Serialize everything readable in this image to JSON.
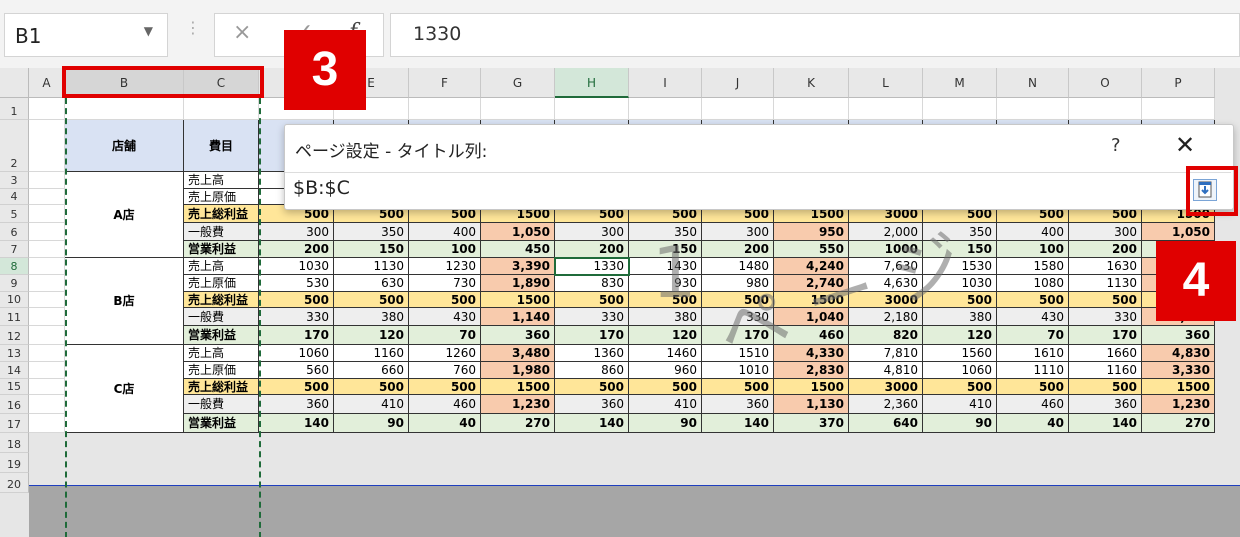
{
  "formula_bar": {
    "name_box": "B1",
    "cancel_icon": "×",
    "enter_icon": "✓",
    "fx_icon": "f",
    "formula_value": "1330"
  },
  "columns": [
    "A",
    "B",
    "C",
    "D",
    "E",
    "F",
    "G",
    "H",
    "I",
    "J",
    "K",
    "L",
    "M",
    "N",
    "O",
    "P"
  ],
  "rows": [
    "1",
    "2",
    "3",
    "4",
    "5",
    "6",
    "7",
    "8",
    "9",
    "10",
    "11",
    "12",
    "13",
    "14",
    "15",
    "16",
    "17",
    "18",
    "19",
    "20"
  ],
  "table": {
    "header": {
      "store": "店舗",
      "item": "費目"
    },
    "stores": [
      "A店",
      "B店",
      "C店"
    ],
    "line_items": [
      "売上高",
      "売上原価",
      "売上総利益",
      "一般費",
      "営業利益"
    ],
    "data": [
      [
        "",
        "",
        "",
        "",
        "",
        "",
        "",
        "",
        "",
        "",
        "",
        "",
        ""
      ],
      [
        "",
        "",
        "",
        "",
        "",
        "",
        "",
        "",
        "",
        "",
        "",
        "",
        ""
      ],
      [
        "500",
        "500",
        "500",
        "1500",
        "500",
        "500",
        "500",
        "1500",
        "3000",
        "500",
        "500",
        "500",
        "1500"
      ],
      [
        "300",
        "350",
        "400",
        "1,050",
        "300",
        "350",
        "300",
        "950",
        "2,000",
        "350",
        "400",
        "300",
        "1,050"
      ],
      [
        "200",
        "150",
        "100",
        "450",
        "200",
        "150",
        "200",
        "550",
        "1000",
        "150",
        "100",
        "200",
        "450"
      ],
      [
        "1030",
        "1130",
        "1230",
        "3,390",
        "1330",
        "1430",
        "1480",
        "4,240",
        "7,630",
        "1530",
        "1580",
        "1630",
        "4,740"
      ],
      [
        "530",
        "630",
        "730",
        "1,890",
        "830",
        "930",
        "980",
        "2,740",
        "4,630",
        "1030",
        "1080",
        "1130",
        "3,240"
      ],
      [
        "500",
        "500",
        "500",
        "1500",
        "500",
        "500",
        "500",
        "1500",
        "3000",
        "500",
        "500",
        "500",
        "1500"
      ],
      [
        "330",
        "380",
        "430",
        "1,140",
        "330",
        "380",
        "330",
        "1,040",
        "2,180",
        "380",
        "430",
        "330",
        "1,140"
      ],
      [
        "170",
        "120",
        "70",
        "360",
        "170",
        "120",
        "170",
        "460",
        "820",
        "120",
        "70",
        "170",
        "360"
      ],
      [
        "1060",
        "1160",
        "1260",
        "3,480",
        "1360",
        "1460",
        "1510",
        "4,330",
        "7,810",
        "1560",
        "1610",
        "1660",
        "4,830"
      ],
      [
        "560",
        "660",
        "760",
        "1,980",
        "860",
        "960",
        "1010",
        "2,830",
        "4,810",
        "1060",
        "1110",
        "1160",
        "3,330"
      ],
      [
        "500",
        "500",
        "500",
        "1500",
        "500",
        "500",
        "500",
        "1500",
        "3000",
        "500",
        "500",
        "500",
        "1500"
      ],
      [
        "360",
        "410",
        "460",
        "1,230",
        "360",
        "410",
        "360",
        "1,130",
        "2,360",
        "410",
        "460",
        "360",
        "1,230"
      ],
      [
        "140",
        "90",
        "40",
        "270",
        "140",
        "90",
        "140",
        "370",
        "640",
        "90",
        "40",
        "140",
        "270"
      ]
    ]
  },
  "dialog": {
    "title": "ページ設定 - タイトル列:",
    "help": "?",
    "close": "✕",
    "value": "$B:$C"
  },
  "watermark": {
    "page_num": "1",
    "page_label": "ページ"
  },
  "annotations": {
    "step3": "3",
    "step4": "4",
    "color": "#e00000"
  }
}
